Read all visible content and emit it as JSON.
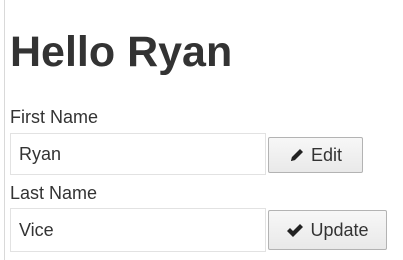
{
  "greeting": {
    "title": "Hello Ryan"
  },
  "form": {
    "first_name": {
      "label": "First Name",
      "value": "Ryan",
      "button_label": "Edit",
      "button_icon": "pencil-icon"
    },
    "last_name": {
      "label": "Last Name",
      "value": "Vice",
      "button_label": "Update",
      "button_icon": "checkmark-icon"
    }
  }
}
